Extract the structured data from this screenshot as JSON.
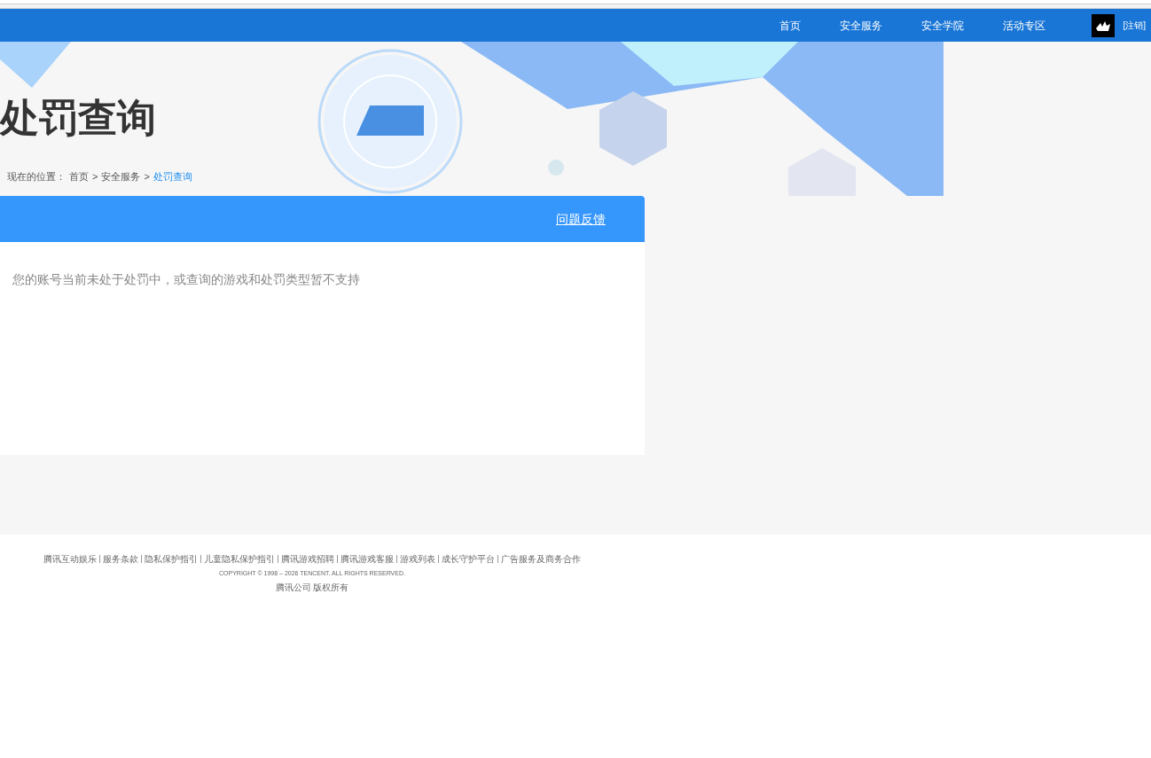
{
  "nav": {
    "items": [
      "首页",
      "安全服务",
      "安全学院",
      "活动专区"
    ],
    "logout": "[注销]"
  },
  "banner": {
    "title": "处罚查询",
    "breadcrumb": {
      "label": "现在的位置：",
      "links": [
        {
          "text": "首页",
          "selected": false
        },
        {
          "text": "安全服务",
          "selected": false
        },
        {
          "text": "处罚查询",
          "selected": true
        }
      ],
      "separator": ">"
    }
  },
  "panel": {
    "feedback": "问题反馈",
    "message": "您的账号当前未处于处罚中，或查询的游戏和处罚类型暂不支持"
  },
  "footer": {
    "links": [
      "腾讯互动娱乐",
      "服务条款",
      "隐私保护指引",
      "儿童隐私保护指引",
      "腾讯游戏招聘",
      "腾讯游戏客服",
      "游戏列表",
      "成长守护平台",
      "广告服务及商务合作"
    ],
    "copyright": "COPYRIGHT © 1998 – 2026 TENCENT. ALL RIGHTS RESERVED.",
    "owner": "腾讯公司 版权所有"
  }
}
